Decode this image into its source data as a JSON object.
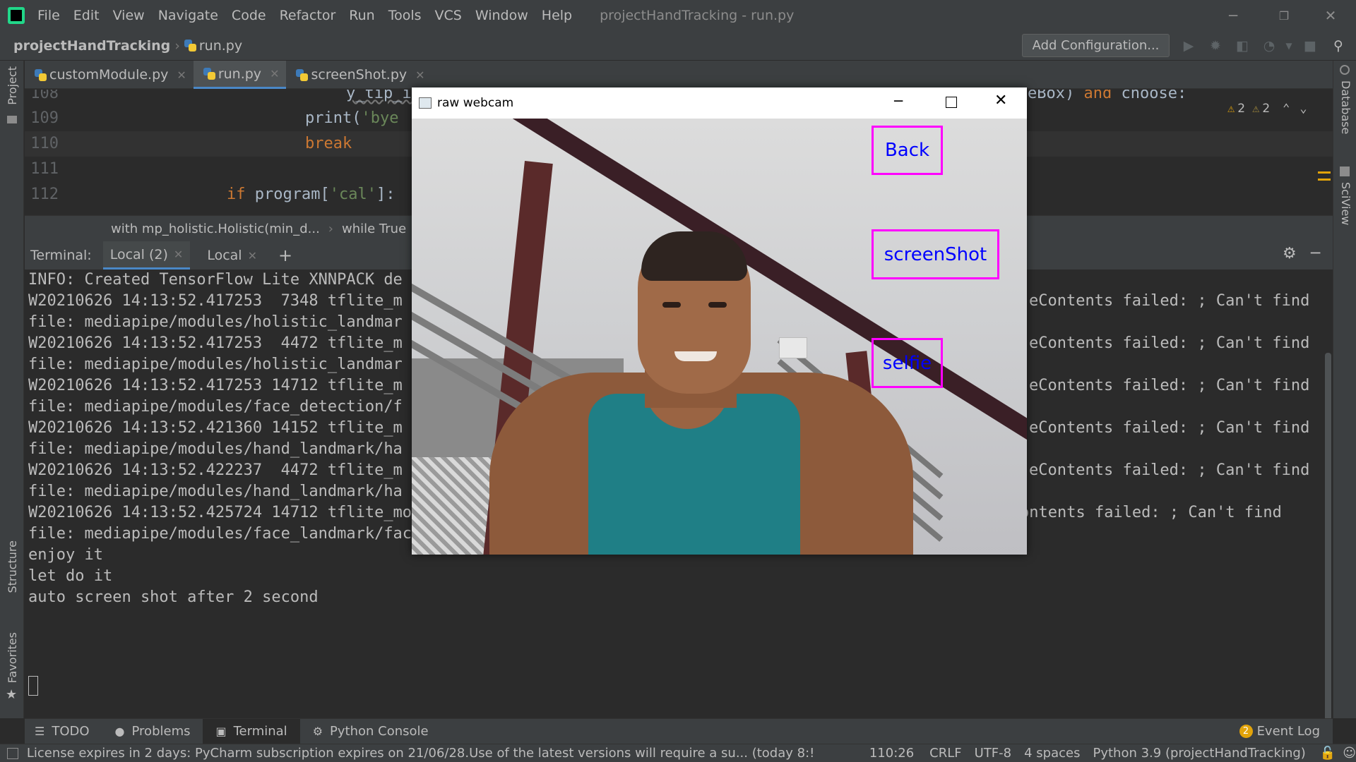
{
  "menubar": {
    "items": [
      "File",
      "Edit",
      "View",
      "Navigate",
      "Code",
      "Refactor",
      "Run",
      "Tools",
      "VCS",
      "Window",
      "Help"
    ],
    "window_title": "projectHandTracking - run.py"
  },
  "navbar": {
    "project": "projectHandTracking",
    "file": "run.py",
    "add_configuration": "Add Configuration..."
  },
  "left_tools": {
    "project": "Project",
    "structure": "Structure",
    "favorites": "Favorites"
  },
  "right_tools": {
    "database": "Database",
    "sciview": "SciView"
  },
  "tabs": [
    {
      "label": "customModule.py"
    },
    {
      "label": "run.py"
    },
    {
      "label": "screenShot.py"
    }
  ],
  "inspection": {
    "warnings": "2",
    "weak_warnings": "2"
  },
  "editor": {
    "lines": [
      {
        "num": "108",
        "tokens": [
          {
            "t": "y_tip_i",
            "c": "fn"
          }
        ],
        "tail": [
          {
            "t": "eBox) ",
            "c": "fn"
          },
          {
            "t": "and",
            "c": "kw"
          },
          {
            "t": " choose:",
            "c": "fn"
          }
        ]
      },
      {
        "num": "109",
        "tokens": [
          {
            "t": "print(",
            "c": "fn"
          },
          {
            "t": "'bye",
            "c": "str"
          }
        ]
      },
      {
        "num": "110",
        "tokens": [
          {
            "t": "break",
            "c": "kw"
          }
        ]
      },
      {
        "num": "111",
        "tokens": []
      },
      {
        "num": "112",
        "tokens": [
          {
            "t": "if ",
            "c": "kw"
          },
          {
            "t": "program[",
            "c": "fn"
          },
          {
            "t": "'cal'",
            "c": "str"
          },
          {
            "t": "]:",
            "c": "fn"
          }
        ]
      }
    ]
  },
  "breadcrumb": {
    "item1": "with mp_holistic.Holistic(min_d...",
    "item2": "while True"
  },
  "terminal": {
    "label": "Terminal:",
    "tabs": [
      "Local (2)",
      "Local"
    ],
    "lines_left": [
      "INFO: Created TensorFlow Lite XNNPACK de",
      "W20210626 14:13:52.417253  7348 tflite_m",
      "file: mediapipe/modules/holistic_landmar",
      "W20210626 14:13:52.417253  4472 tflite_m",
      "file: mediapipe/modules/holistic_landmar",
      "W20210626 14:13:52.417253 14712 tflite_m",
      "file: mediapipe/modules/face_detection/f",
      "W20210626 14:13:52.421360 14152 tflite_m",
      "file: mediapipe/modules/hand_landmark/ha",
      "W20210626 14:13:52.422237  4472 tflite_m",
      "file: mediapipe/modules/hand_landmark/ha"
    ],
    "lines_right": [
      "",
      "eContents failed: ; Can't find",
      "",
      "eContents failed: ; Can't find",
      "",
      "eContents failed: ; Can't find",
      "",
      "eContents failed: ; Can't find",
      "",
      "eContents failed: ; Can't find",
      ""
    ],
    "lines_full": [
      "W20210626 14:13:52.425724 14712 tflite_model_loader.cc:32] Trying to resolve path manually as GetResourceContents failed: ; Can't find",
      "file: mediapipe/modules/face_landmark/face_landmark.tflite",
      "enjoy it",
      "let do it",
      "auto screen shot after 2 second"
    ]
  },
  "bottom_tabs": [
    {
      "icon": "todo-icon",
      "label": "TODO"
    },
    {
      "icon": "problems-icon",
      "label": "Problems"
    },
    {
      "icon": "terminal-icon",
      "label": "Terminal"
    },
    {
      "icon": "python-console-icon",
      "label": "Python Console"
    }
  ],
  "event_log": {
    "count": "2",
    "label": "Event Log"
  },
  "status": {
    "message": "License expires in 2 days: PyCharm subscription expires on 21/06/28.Use of the latest versions will require a su... (today 8:!",
    "position": "110:26",
    "line_sep": "CRLF",
    "encoding": "UTF-8",
    "indent": "4 spaces",
    "interpreter": "Python 3.9 (projectHandTracking)"
  },
  "webcam": {
    "title": "raw webcam",
    "buttons": [
      {
        "label": "Back"
      },
      {
        "label": "screenShot"
      },
      {
        "label": "selfie"
      }
    ],
    "button_border_color": "#ff00ff",
    "button_text_color": "#0000ff"
  },
  "colors": {
    "accent": "#4a88c7",
    "keyword": "#cc7832",
    "string": "#6a8759",
    "warning": "#e2a30a"
  }
}
